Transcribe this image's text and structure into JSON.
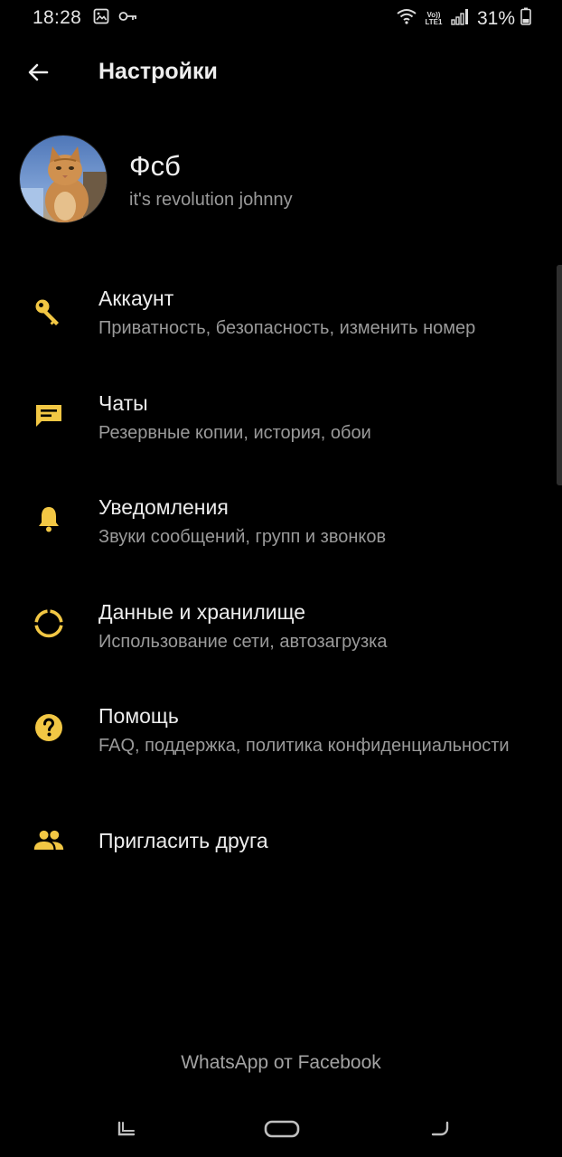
{
  "status_bar": {
    "time": "18:28",
    "battery": "31%",
    "icons": [
      "gallery-icon",
      "key-icon",
      "wifi-icon",
      "volte-icon",
      "signal-icon",
      "battery-icon"
    ],
    "volte_label": "Vo)) LTE1"
  },
  "app_bar": {
    "title": "Настройки",
    "back_icon": "arrow-left-icon"
  },
  "profile": {
    "name": "Фсб",
    "status": "it's revolution johnny"
  },
  "accent_color": "#f2c744",
  "settings": [
    {
      "icon": "key-icon",
      "title": "Аккаунт",
      "subtitle": "Приватность, безопасность, изменить номер"
    },
    {
      "icon": "chat-icon",
      "title": "Чаты",
      "subtitle": "Резервные копии, история, обои"
    },
    {
      "icon": "bell-icon",
      "title": "Уведомления",
      "subtitle": "Звуки сообщений, групп и звонков"
    },
    {
      "icon": "data-usage-icon",
      "title": "Данные и хранилище",
      "subtitle": "Использование сети, автозагрузка"
    },
    {
      "icon": "help-icon",
      "title": "Помощь",
      "subtitle": "FAQ, поддержка, политика конфиденциальности"
    },
    {
      "icon": "people-icon",
      "title": "Пригласить друга",
      "subtitle": ""
    }
  ],
  "footer": "WhatsApp от Facebook",
  "nav_bar": {
    "buttons": [
      "recent-apps-icon",
      "home-icon",
      "back-nav-icon"
    ]
  }
}
